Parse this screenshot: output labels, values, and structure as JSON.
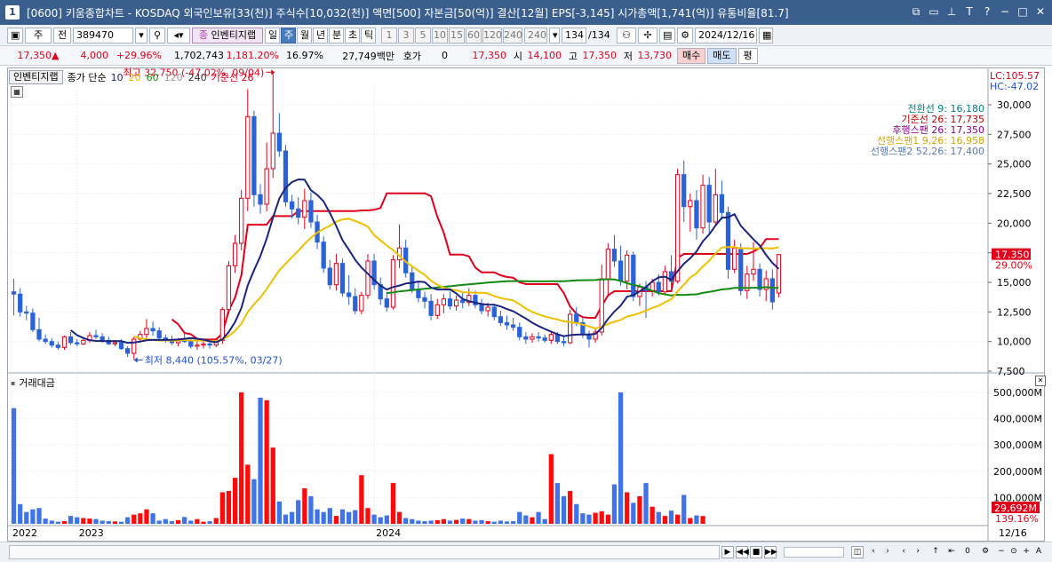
{
  "window": {
    "app_number": "1",
    "title": "[0600] 키움종합차트 - KOSDAQ 외국인보유[33(천)] 주식수[10,032(천)] 액면[500] 자본금[50(억)] 결산[12월] EPS[-3,145] 시가총액[1,741(억)] 유통비율[81.7]"
  },
  "toolbar": {
    "mode_label": "주",
    "range_label": "전",
    "code_value": "389470",
    "indicator_label": "인벤티지랩",
    "period_buttons": [
      "일",
      "주",
      "월",
      "년",
      "분",
      "초",
      "틱"
    ],
    "selected_period": "주",
    "interval_buttons": [
      "1",
      "3",
      "5",
      "10",
      "15",
      "60",
      "120",
      "240"
    ],
    "interval_select": "240",
    "count_value": "134",
    "count_total": "/134",
    "date_value": "2024/12/16"
  },
  "quote": {
    "price": "17,350",
    "change": "4,000",
    "change_pct": "+29.96%",
    "volume": "1,702,743",
    "volume_pct": "1,181.20%",
    "turnover": "16.97%",
    "amount": "27,749백만",
    "hoga_label": "호가",
    "hoga_value": "0",
    "hoga_price": "17,350",
    "open_label": "시",
    "open": "14,100",
    "high_label": "고",
    "high": "17,350",
    "low_label": "저",
    "low": "13,730",
    "buy_label": "매수",
    "sell_label": "매도",
    "flat_label": "평"
  },
  "legend": {
    "name": "인벤티지랩",
    "price_label": "종가 단순",
    "ma": [
      {
        "label": "10",
        "color": "#1a237e"
      },
      {
        "label": "20",
        "color": "#e6b800"
      },
      {
        "label": "60",
        "color": "#138a13"
      },
      {
        "label": "120",
        "color": "#999999"
      },
      {
        "label": "240",
        "color": "#333333"
      }
    ],
    "base_label": "기준선 26"
  },
  "lc_label": "LC:105.57",
  "hc_label": "HC:-47.02",
  "ichimoku": [
    {
      "label": "전환선 9: 16,180",
      "color": "#008080"
    },
    {
      "label": "기준선 26: 17,735",
      "color": "#c00000"
    },
    {
      "label": "후행스팬 26: 17,350",
      "color": "#8b008b"
    },
    {
      "label": "선행스팬1 9,26: 16,958",
      "color": "#d9a400"
    },
    {
      "label": "선행스팬2 52,26: 17,400",
      "color": "#5a7ab0"
    }
  ],
  "annotations": {
    "high": "최고 32,750 (-47.02%, 09/04)",
    "low": "최저 8,440 (105.57%, 03/27)"
  },
  "price_axis": {
    "ticks": [
      "30,000",
      "27,500",
      "25,000",
      "22,500",
      "20,000",
      "17,500",
      "15,000",
      "12,500",
      "10,000",
      "7,500"
    ],
    "current_price": "17,350",
    "current_pct": "29.00%"
  },
  "volume_panel": {
    "title": "거래대금",
    "ticks": [
      "500,000M",
      "400,000M",
      "300,000M",
      "200,000M",
      "100,000M"
    ],
    "current_value": "29,692M",
    "current_pct": "139.16%"
  },
  "time_axis": {
    "labels": [
      "2022",
      "2023",
      "2024"
    ],
    "end_label": "12/16"
  },
  "chart_data": {
    "type": "candlestick",
    "unit": "weekly",
    "ylim": [
      7500,
      31500
    ],
    "candles": [
      [
        14200,
        15300,
        12200,
        14000
      ],
      [
        14000,
        14500,
        12100,
        12500
      ],
      [
        12500,
        13000,
        11800,
        12400
      ],
      [
        12400,
        12800,
        10800,
        11000
      ],
      [
        11000,
        12000,
        10000,
        10200
      ],
      [
        10200,
        10600,
        9800,
        10000
      ],
      [
        10000,
        10300,
        9500,
        9700
      ],
      [
        9700,
        10000,
        9300,
        9500
      ],
      [
        9500,
        10500,
        9300,
        10400
      ],
      [
        10400,
        10800,
        9700,
        9900
      ],
      [
        9900,
        10200,
        9600,
        9800
      ],
      [
        9800,
        10300,
        9700,
        10100
      ],
      [
        10100,
        10800,
        9900,
        10500
      ],
      [
        10500,
        11000,
        10200,
        10400
      ],
      [
        10400,
        10700,
        9900,
        10100
      ],
      [
        10100,
        10400,
        9700,
        9800
      ],
      [
        9800,
        10100,
        9600,
        9900
      ],
      [
        9900,
        10200,
        9300,
        9400
      ],
      [
        9400,
        9600,
        8700,
        9000
      ],
      [
        9000,
        10400,
        8440,
        10200
      ],
      [
        10200,
        10900,
        9900,
        10600
      ],
      [
        10600,
        11900,
        10300,
        11100
      ],
      [
        11100,
        11700,
        10500,
        10900
      ],
      [
        10900,
        11200,
        10100,
        10300
      ],
      [
        10300,
        10600,
        9900,
        10100
      ],
      [
        10100,
        10500,
        9700,
        9900
      ],
      [
        9900,
        10300,
        9600,
        10200
      ],
      [
        10200,
        10700,
        9900,
        10000
      ],
      [
        10000,
        10300,
        9400,
        9600
      ],
      [
        9600,
        10000,
        9300,
        9700
      ],
      [
        9700,
        10100,
        9400,
        9800
      ],
      [
        9800,
        10100,
        9400,
        9700
      ],
      [
        9700,
        10300,
        9500,
        10100
      ],
      [
        10100,
        12900,
        9800,
        12700
      ],
      [
        12700,
        16800,
        12300,
        16400
      ],
      [
        16400,
        19000,
        15800,
        18300
      ],
      [
        18300,
        22800,
        17700,
        22100
      ],
      [
        22100,
        31300,
        21000,
        29000
      ],
      [
        29000,
        29500,
        21400,
        22400
      ],
      [
        22400,
        23300,
        20800,
        21600
      ],
      [
        21600,
        26800,
        21000,
        24600
      ],
      [
        24600,
        32750,
        23800,
        27600
      ],
      [
        27600,
        29300,
        25600,
        26100
      ],
      [
        26100,
        26600,
        21400,
        21800
      ],
      [
        21800,
        22400,
        20400,
        21200
      ],
      [
        21200,
        22200,
        19900,
        20500
      ],
      [
        20500,
        22900,
        19500,
        21900
      ],
      [
        21900,
        22600,
        19600,
        20100
      ],
      [
        20100,
        20700,
        17800,
        18400
      ],
      [
        18400,
        18900,
        15800,
        16200
      ],
      [
        16200,
        16900,
        14400,
        14800
      ],
      [
        14800,
        17400,
        14300,
        16600
      ],
      [
        16600,
        17000,
        13800,
        14100
      ],
      [
        14100,
        15600,
        13100,
        13800
      ],
      [
        13800,
        14500,
        12300,
        12600
      ],
      [
        12600,
        14200,
        12300,
        13900
      ],
      [
        13900,
        17400,
        13600,
        16800
      ],
      [
        16800,
        17400,
        14400,
        14800
      ],
      [
        14800,
        15400,
        13100,
        13600
      ],
      [
        13600,
        14200,
        12500,
        12900
      ],
      [
        12900,
        17300,
        12700,
        16900
      ],
      [
        16900,
        19900,
        16200,
        17900
      ],
      [
        17900,
        18600,
        15400,
        15800
      ],
      [
        15800,
        16300,
        14100,
        14400
      ],
      [
        14400,
        15100,
        13300,
        13700
      ],
      [
        13700,
        14200,
        12800,
        13400
      ],
      [
        13400,
        14000,
        11800,
        12200
      ],
      [
        12200,
        13600,
        11900,
        13100
      ],
      [
        13100,
        14000,
        12400,
        13600
      ],
      [
        13600,
        14200,
        12700,
        13000
      ],
      [
        13000,
        13900,
        12600,
        13500
      ],
      [
        13500,
        14100,
        12800,
        13300
      ],
      [
        13300,
        14500,
        13000,
        13900
      ],
      [
        13900,
        14300,
        12800,
        13100
      ],
      [
        13100,
        13600,
        12300,
        12600
      ],
      [
        12600,
        13300,
        12100,
        12900
      ],
      [
        12900,
        13200,
        11800,
        12100
      ],
      [
        12100,
        12600,
        11300,
        11600
      ],
      [
        11600,
        12200,
        11000,
        11400
      ],
      [
        11400,
        12000,
        10900,
        11200
      ],
      [
        11200,
        11600,
        10100,
        10400
      ],
      [
        10400,
        10800,
        9800,
        10200
      ],
      [
        10200,
        10700,
        9900,
        10400
      ],
      [
        10400,
        10800,
        10000,
        10300
      ],
      [
        10300,
        10600,
        9900,
        10100
      ],
      [
        10100,
        10900,
        9800,
        10600
      ],
      [
        10600,
        10800,
        9800,
        10000
      ],
      [
        10000,
        10400,
        9600,
        9900
      ],
      [
        9900,
        12700,
        9800,
        12300
      ],
      [
        12300,
        12900,
        11300,
        11600
      ],
      [
        11600,
        12100,
        10300,
        10600
      ],
      [
        10600,
        10900,
        9500,
        10200
      ],
      [
        10200,
        11100,
        9900,
        10800
      ],
      [
        10800,
        16500,
        10500,
        15300
      ],
      [
        15300,
        18300,
        13800,
        17800
      ],
      [
        17800,
        19000,
        16300,
        16800
      ],
      [
        16800,
        18100,
        14700,
        15100
      ],
      [
        15100,
        17700,
        14400,
        17300
      ],
      [
        17300,
        17600,
        13400,
        13800
      ],
      [
        13800,
        14900,
        13000,
        14600
      ],
      [
        14600,
        15100,
        12000,
        14300
      ],
      [
        14300,
        15300,
        13800,
        15000
      ],
      [
        15000,
        15700,
        13900,
        14200
      ],
      [
        14200,
        16400,
        13900,
        15900
      ],
      [
        15900,
        17300,
        14400,
        15100
      ],
      [
        15100,
        24600,
        14900,
        24100
      ],
      [
        24100,
        25300,
        20100,
        21400
      ],
      [
        21400,
        22500,
        19300,
        21900
      ],
      [
        21900,
        22800,
        18600,
        19600
      ],
      [
        19600,
        24100,
        19100,
        23200
      ],
      [
        23200,
        23900,
        19200,
        20100
      ],
      [
        20100,
        24600,
        19800,
        22400
      ],
      [
        22400,
        23600,
        20300,
        20900
      ],
      [
        20900,
        21400,
        15300,
        16100
      ],
      [
        16100,
        18600,
        15800,
        17900
      ],
      [
        17900,
        18300,
        13900,
        14300
      ],
      [
        14300,
        16400,
        13600,
        15700
      ],
      [
        15700,
        18400,
        15100,
        16100
      ],
      [
        16100,
        16600,
        13800,
        14400
      ],
      [
        14400,
        16000,
        13400,
        15300
      ],
      [
        15300,
        16100,
        12700,
        13350
      ],
      [
        14100,
        17350,
        13730,
        17350
      ]
    ],
    "volume_millions": [
      440000,
      75000,
      45000,
      55000,
      60000,
      20000,
      12000,
      8000,
      10000,
      30000,
      25000,
      22000,
      20000,
      18000,
      12000,
      10000,
      9000,
      8000,
      25000,
      35000,
      40000,
      55000,
      40000,
      12000,
      18000,
      10000,
      14000,
      26000,
      12000,
      18000,
      8000,
      10000,
      22000,
      120000,
      125000,
      175000,
      500000,
      225000,
      170000,
      480000,
      470000,
      290000,
      85000,
      35000,
      45000,
      90000,
      135000,
      105000,
      55000,
      45000,
      60000,
      30000,
      55000,
      45000,
      52000,
      185000,
      60000,
      35000,
      25000,
      32000,
      155000,
      45000,
      22000,
      18000,
      12000,
      10000,
      12000,
      14000,
      18000,
      12000,
      15000,
      20000,
      18000,
      12000,
      14000,
      10000,
      8000,
      12000,
      9000,
      10000,
      45000,
      32000,
      25000,
      45000,
      18000,
      265000,
      155000,
      105000,
      125000,
      75000,
      40000,
      35000,
      42000,
      48000,
      35000,
      150000,
      500000,
      120000,
      80000,
      105000,
      155000,
      65000,
      45000,
      30000,
      50000,
      35000,
      110000,
      22000,
      32000,
      29692
    ],
    "ma10": "navy",
    "ma20": "gold",
    "ma60": "green",
    "base_line_26": "red"
  }
}
